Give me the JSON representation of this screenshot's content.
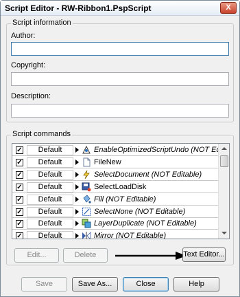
{
  "window": {
    "title": "Script Editor - RW-Ribbon1.PspScript",
    "close_glyph": "X"
  },
  "script_information": {
    "group_label": "Script information",
    "author_label": "Author:",
    "author_value": "",
    "copyright_label": "Copyright:",
    "copyright_value": "",
    "description_label": "Description:",
    "description_value": ""
  },
  "script_commands": {
    "group_label": "Script commands",
    "rows": [
      {
        "checked": true,
        "mode": "Default",
        "icon": "optimize-icon",
        "name": "EnableOptimizedScriptUndo (NOT Editable)",
        "editable": false
      },
      {
        "checked": true,
        "mode": "Default",
        "icon": "new-file-icon",
        "name": "FileNew",
        "editable": true
      },
      {
        "checked": true,
        "mode": "Default",
        "icon": "lightning-icon",
        "name": "SelectDocument (NOT Editable)",
        "editable": false
      },
      {
        "checked": true,
        "mode": "Default",
        "icon": "load-disk-icon",
        "name": "SelectLoadDisk",
        "editable": true
      },
      {
        "checked": true,
        "mode": "Default",
        "icon": "fill-bucket-icon",
        "name": "Fill (NOT Editable)",
        "editable": false
      },
      {
        "checked": true,
        "mode": "Default",
        "icon": "select-none-icon",
        "name": "SelectNone (NOT Editable)",
        "editable": false
      },
      {
        "checked": true,
        "mode": "Default",
        "icon": "layer-duplicate-icon",
        "name": "LayerDuplicate (NOT Editable)",
        "editable": false
      },
      {
        "checked": true,
        "mode": "Default",
        "icon": "mirror-icon",
        "name": "Mirror (NOT Editable)",
        "editable": false
      }
    ],
    "edit_button": "Edit...",
    "delete_button": "Delete",
    "text_editor_button": "Text Editor..."
  },
  "footer": {
    "save_button": "Save",
    "save_as_button": "Save As...",
    "close_button": "Close",
    "help_button": "Help"
  },
  "colors": {
    "accent": "#3d7bad",
    "close": "#c8412a"
  }
}
